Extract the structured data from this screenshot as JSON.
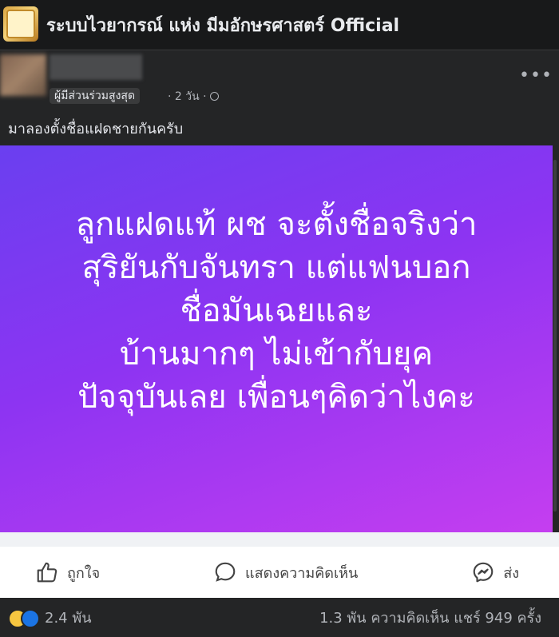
{
  "header": {
    "group_name": "ระบบไวยากรณ์ แห่ง มีมอักษรศาสตร์ Official"
  },
  "post": {
    "badge": "ผู้มีส่วนร่วมสูงสุด",
    "timestamp": "· 2 วัน ·",
    "text": "มาลองตั้งชื่อแฝดชายกันครับ",
    "more_icon": "more-horizontal-icon",
    "image_lines": [
      "ลูกแฝดแท้ ผช จะตั้งชื่อจริงว่า",
      "สุริยันกับจันทรา แต่แฟนบอก",
      "ชื่อมันเฉยและ",
      "บ้านมากๆ ไม่เข้ากับยุค",
      "ปัจจุบันเลย เพื่อนๆคิดว่าไงคะ"
    ]
  },
  "actions": {
    "like": "ถูกใจ",
    "comment": "แสดงความคิดเห็น",
    "share": "ส่ง"
  },
  "footer": {
    "reaction_count": "2.4 พัน",
    "comments_shares": "1.3 พัน ความคิดเห็น  แชร์ 949 ครั้ง"
  },
  "colors": {
    "background": "#18191a",
    "card": "#242526",
    "gradient_start": "#6a3ff0",
    "gradient_end": "#c53ef0",
    "like_blue": "#1b74e4"
  }
}
